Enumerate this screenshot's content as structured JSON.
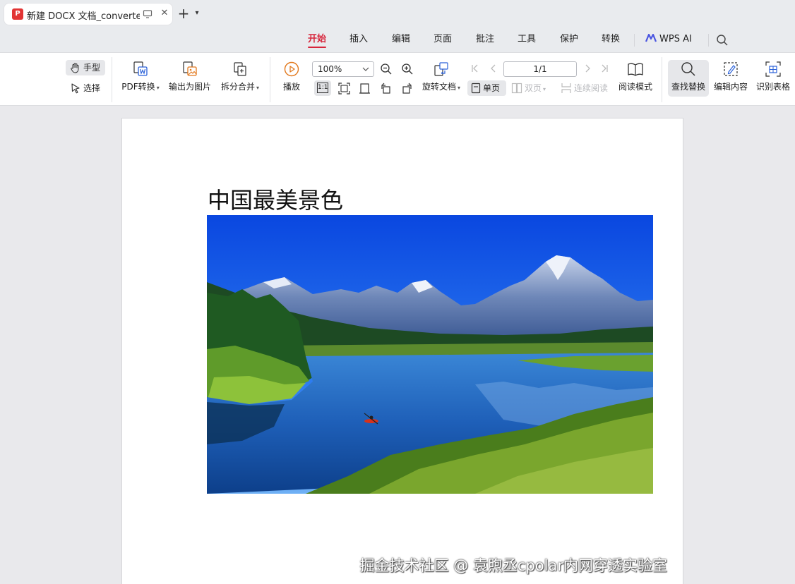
{
  "tab": {
    "title": "新建 DOCX 文档_converted",
    "logo_text": "P"
  },
  "menu": {
    "tabs": [
      "开始",
      "插入",
      "编辑",
      "页面",
      "批注",
      "工具",
      "保护",
      "转换"
    ],
    "active_tab": "开始",
    "ai_label": "WPS AI",
    "accent_color": "#d7263c"
  },
  "ribbon": {
    "hand_label": "手型",
    "select_label": "选择",
    "pdf_convert_label": "PDF转换",
    "export_image_label": "输出为图片",
    "split_merge_label": "拆分合并",
    "play_label": "播放",
    "zoom_value": "100%",
    "rotate_doc_label": "旋转文档",
    "page_indicator": "1/1",
    "single_page_label": "单页",
    "double_page_label": "双页",
    "continuous_label": "连续阅读",
    "read_mode_label": "阅读模式",
    "find_replace_label": "查找替换",
    "edit_content_label": "编辑内容",
    "recognize_table_label": "识别表格",
    "actual_size_label": "1:1"
  },
  "document": {
    "heading": "中国最美景色",
    "watermark": "掘金技术社区 @ 袁煦丞cpolar内网穿透实验室"
  }
}
